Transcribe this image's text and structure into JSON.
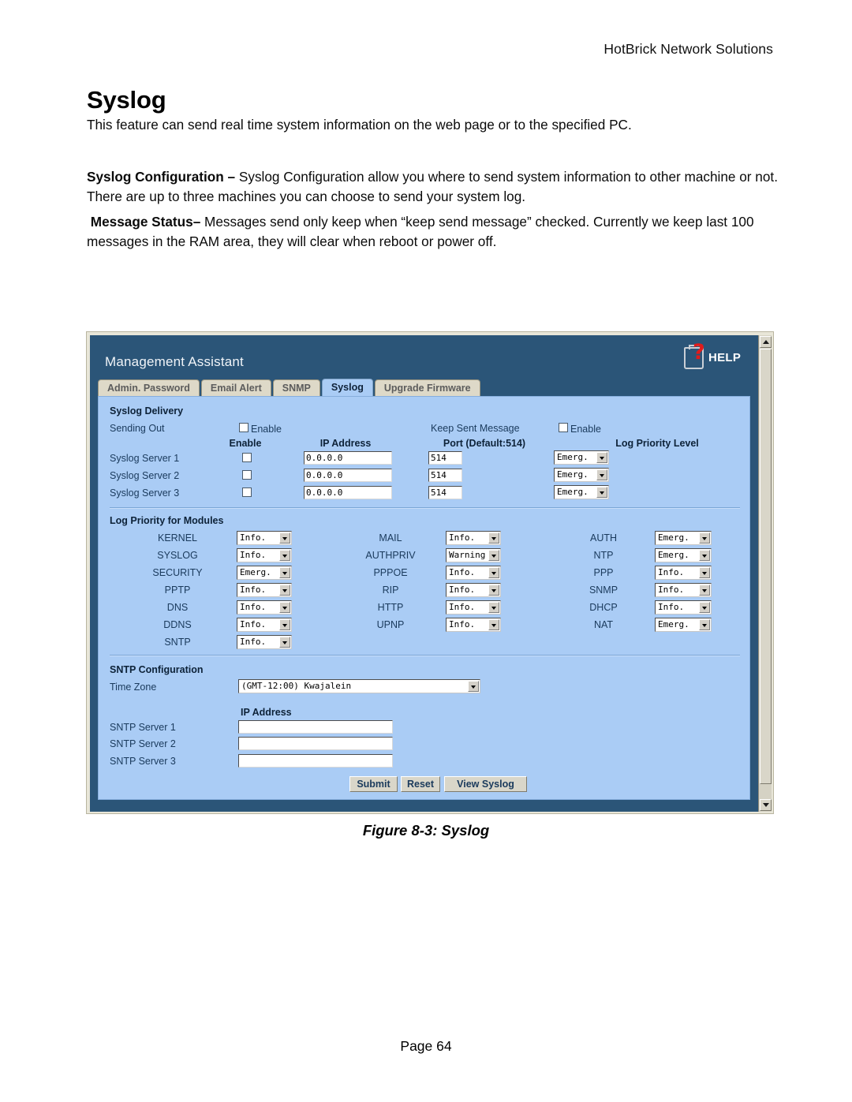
{
  "document": {
    "header": "HotBrick Network Solutions",
    "title": "Syslog",
    "intro": "This feature can send real time system information on the web page or to the specified PC.",
    "config_label": "Syslog Configuration –",
    "config_text": " Syslog Configuration allow you where to send system information to other machine or not. There are up to three machines you can choose to send your system log.",
    "message_label": "Message Status–",
    "message_text": " Messages send only keep when “keep send message” checked. Currently we keep last 100 messages in the RAM area, they will clear when reboot or power off.",
    "figure_caption": "Figure 8-3: Syslog",
    "page_footer": "Page 64"
  },
  "colors": {
    "header_navy": "#2b5578",
    "content_blue": "#aaccf5",
    "tab_inactive": "#ded9c8",
    "frame_cream": "#e8e6d8",
    "help_red": "#e01b1b"
  },
  "app": {
    "title": "Management Assistant",
    "help_label": "HELP",
    "tabs": [
      {
        "label": "Admin. Password",
        "active": false
      },
      {
        "label": "Email Alert",
        "active": false
      },
      {
        "label": "SNMP",
        "active": false
      },
      {
        "label": "Syslog",
        "active": true
      },
      {
        "label": "Upgrade Firmware",
        "active": false
      }
    ]
  },
  "syslog_delivery": {
    "section_title": "Syslog Delivery",
    "sending_out_label": "Sending Out",
    "sending_out_enable_label": "Enable",
    "sending_out_checked": false,
    "keep_sent_label": "Keep Sent Message",
    "keep_sent_enable_label": "Enable",
    "keep_sent_checked": false,
    "columns": {
      "enable": "Enable",
      "ip_address": "IP Address",
      "port": "Port (Default:514)",
      "priority": "Log Priority Level"
    },
    "servers": [
      {
        "label": "Syslog Server 1",
        "enabled": false,
        "ip": "0.0.0.0",
        "port": "514",
        "priority": "Emerg."
      },
      {
        "label": "Syslog Server 2",
        "enabled": false,
        "ip": "0.0.0.0",
        "port": "514",
        "priority": "Emerg."
      },
      {
        "label": "Syslog Server 3",
        "enabled": false,
        "ip": "0.0.0.0",
        "port": "514",
        "priority": "Emerg."
      }
    ]
  },
  "log_priority_modules": {
    "section_title": "Log Priority for Modules",
    "col1": [
      {
        "label": "KERNEL",
        "value": "Info."
      },
      {
        "label": "SYSLOG",
        "value": "Info."
      },
      {
        "label": "SECURITY",
        "value": "Emerg."
      },
      {
        "label": "PPTP",
        "value": "Info."
      },
      {
        "label": "DNS",
        "value": "Info."
      },
      {
        "label": "DDNS",
        "value": "Info."
      },
      {
        "label": "SNTP",
        "value": "Info."
      }
    ],
    "col2": [
      {
        "label": "MAIL",
        "value": "Info."
      },
      {
        "label": "AUTHPRIV",
        "value": "Warning"
      },
      {
        "label": "PPPOE",
        "value": "Info."
      },
      {
        "label": "RIP",
        "value": "Info."
      },
      {
        "label": "HTTP",
        "value": "Info."
      },
      {
        "label": "UPNP",
        "value": "Info."
      }
    ],
    "col3": [
      {
        "label": "AUTH",
        "value": "Emerg."
      },
      {
        "label": "NTP",
        "value": "Emerg."
      },
      {
        "label": "PPP",
        "value": "Info."
      },
      {
        "label": "SNMP",
        "value": "Info."
      },
      {
        "label": "DHCP",
        "value": "Info."
      },
      {
        "label": "NAT",
        "value": "Emerg."
      }
    ]
  },
  "sntp": {
    "section_title": "SNTP Configuration",
    "time_zone_label": "Time Zone",
    "time_zone_value": "(GMT-12:00) Kwajalein",
    "ip_address_header": "IP Address",
    "servers": [
      {
        "label": "SNTP Server 1",
        "value": ""
      },
      {
        "label": "SNTP Server 2",
        "value": ""
      },
      {
        "label": "SNTP Server 3",
        "value": ""
      }
    ]
  },
  "actions": {
    "submit": "Submit",
    "reset": "Reset",
    "view_syslog": "View Syslog"
  }
}
